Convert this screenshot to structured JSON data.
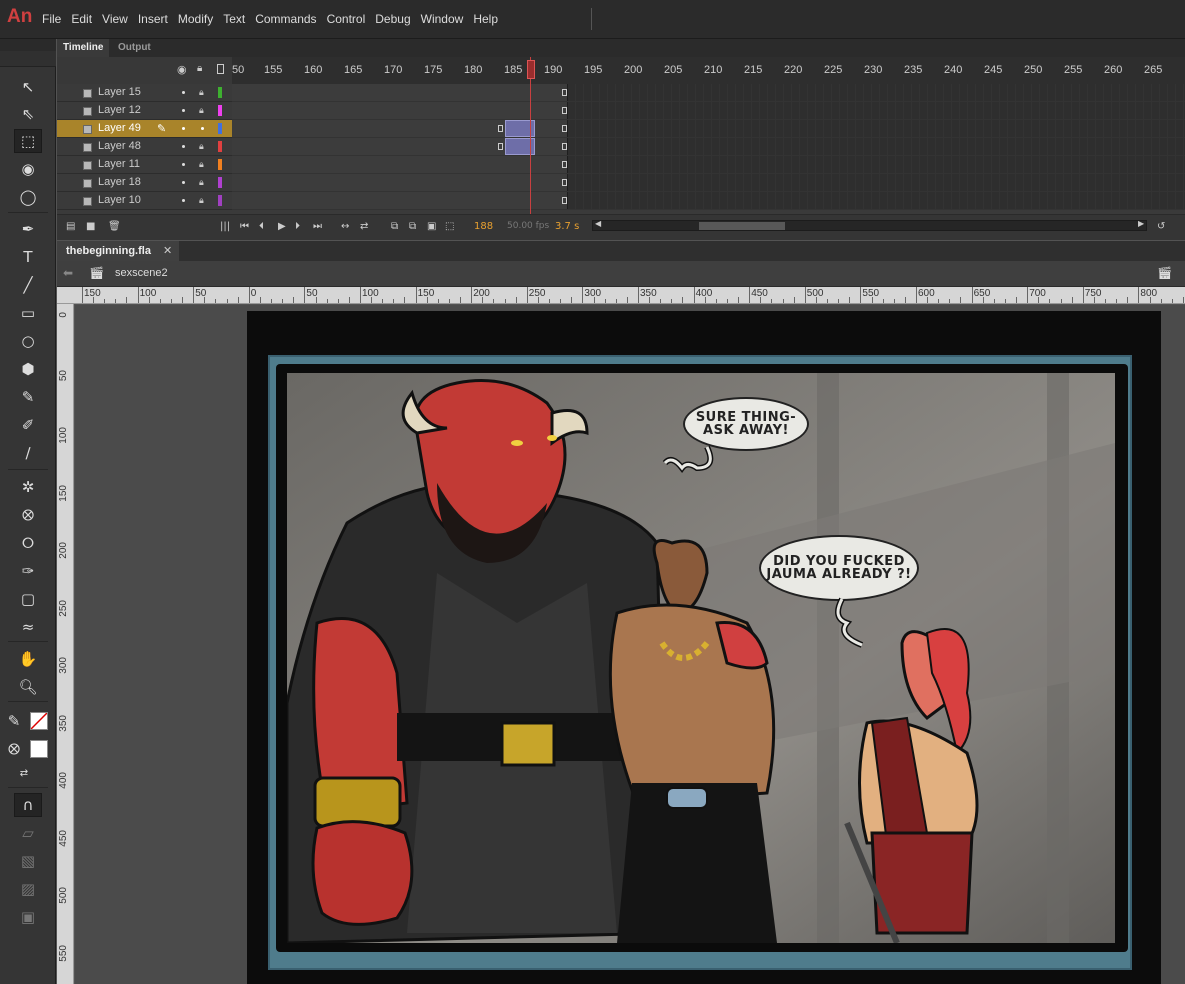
{
  "app": {
    "logo": "An"
  },
  "menu": [
    "File",
    "Edit",
    "View",
    "Insert",
    "Modify",
    "Text",
    "Commands",
    "Control",
    "Debug",
    "Window",
    "Help"
  ],
  "timeline": {
    "tabs": {
      "timeline": "Timeline",
      "output": "Output"
    },
    "frame_numbers": [
      "50",
      "155",
      "160",
      "165",
      "170",
      "175",
      "180",
      "185",
      "190",
      "195",
      "200",
      "205",
      "210",
      "215",
      "220",
      "225",
      "230",
      "235",
      "240",
      "245",
      "250",
      "255",
      "260",
      "265"
    ],
    "layers": [
      {
        "name": "Layer 15",
        "color": "#3eb030",
        "active": false
      },
      {
        "name": "Layer 12",
        "color": "#ee40ee",
        "active": false
      },
      {
        "name": "Layer 49",
        "color": "#4070e0",
        "active": true
      },
      {
        "name": "Layer 48",
        "color": "#e04040",
        "active": false
      },
      {
        "name": "Layer 11",
        "color": "#f08020",
        "active": false
      },
      {
        "name": "Layer 18",
        "color": "#b040d0",
        "active": false
      },
      {
        "name": "Layer 10",
        "color": "#a040c0",
        "active": false
      }
    ],
    "current_frame": "188",
    "fps": "50.00 fps",
    "elapsed": "3.7 s"
  },
  "document": {
    "filename": "thebeginning.fla",
    "scene": "sexscene2"
  },
  "ruler": {
    "h": [
      "150",
      "100",
      "50",
      "0",
      "50",
      "100",
      "150",
      "200",
      "250",
      "300",
      "350",
      "400",
      "450",
      "500",
      "550",
      "600",
      "650",
      "700",
      "750",
      "800"
    ],
    "v": [
      "0",
      "50",
      "100",
      "150",
      "200",
      "250",
      "300",
      "350",
      "400",
      "450",
      "500",
      "550"
    ]
  },
  "comic": {
    "bubble1": "SURE THING-\nASK AWAY!",
    "bubble2": "DID YOU FUCKED\nJAUMA ALREADY ?!",
    "colors": {
      "wall": "#8d8a85",
      "frame": "#4f7c8c",
      "skin_red": "#c23a35",
      "cloak": "#2a2a2a",
      "hair_red": "#d84040"
    }
  }
}
